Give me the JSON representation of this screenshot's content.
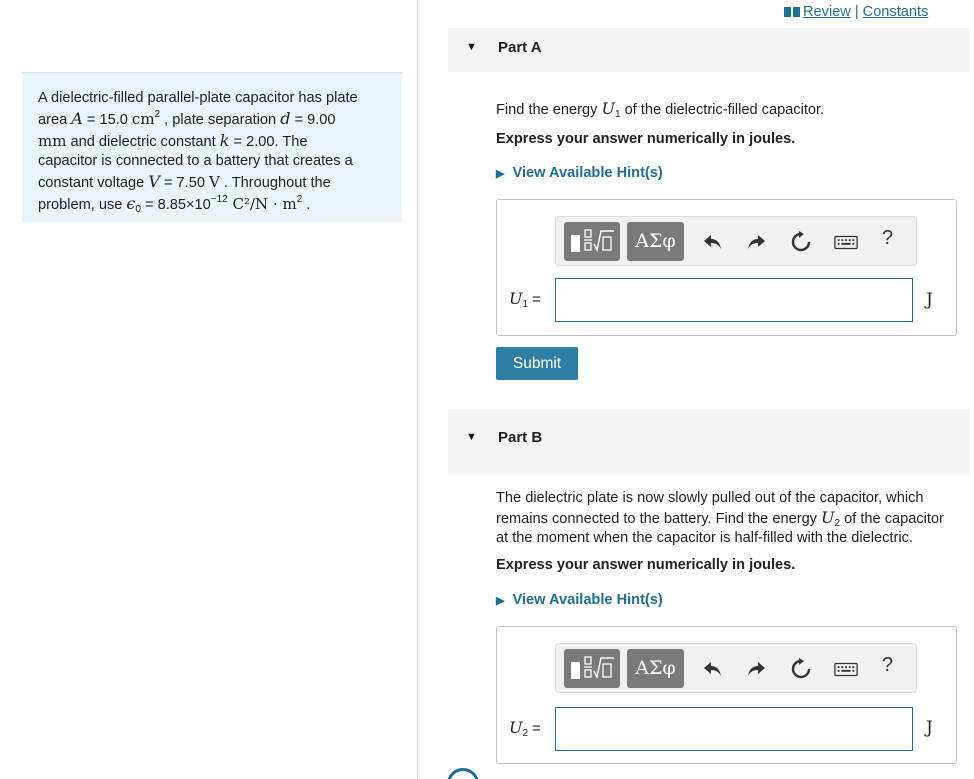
{
  "header": {
    "review_label": "Review",
    "separator": "|",
    "constants_label": "Constants"
  },
  "problem": {
    "l1": "A dielectric-filled parallel-plate capacitor has plate",
    "l2_a": "area ",
    "l2_A": "A",
    "l2_b": " = 15.0 ",
    "l2_unit": "cm",
    "l2_unit_exp": "2",
    "l2_c": " , plate separation ",
    "l2_d": "d",
    "l2_e": " = 9.00",
    "l3_unit": "mm",
    "l3_a": " and dielectric constant ",
    "l3_k": "k",
    "l3_b": " = 2.00. The",
    "l4": "capacitor is connected to a battery that creates a",
    "l5_a": "constant voltage ",
    "l5_V": "V",
    "l5_b": " = 7.50 ",
    "l5_unit": "V",
    "l5_c": " . Throughout the",
    "l6_a": "problem, use ",
    "l6_eps": "ϵ",
    "l6_eps_sub": "0",
    "l6_b": " = 8.85×10",
    "l6_exp": "−12",
    "l6_unit": " C²/N · m",
    "l6_unit_exp": "2",
    "l6_c": " ."
  },
  "partA": {
    "title": "Part A",
    "q_a": "Find the energy ",
    "q_var": "U",
    "q_sub": "1",
    "q_b": " of the dielectric-filled capacitor.",
    "instruction": "Express your answer numerically in joules.",
    "hint": "View Available Hint(s)",
    "var": "U",
    "var_sub": "1",
    "eq": "=",
    "value": "",
    "unit": "J",
    "submit": "Submit"
  },
  "partB": {
    "title": "Part B",
    "q1": "The dielectric plate is now slowly pulled out of the capacitor, which",
    "q2_a": "remains connected to the battery. Find the energy ",
    "q2_var": "U",
    "q2_sub": "2",
    "q2_b": " of the capacitor",
    "q3": "at the moment when the capacitor is half-filled with the dielectric.",
    "instruction": "Express your answer numerically in joules.",
    "hint": "View Available Hint(s)",
    "var": "U",
    "var_sub": "2",
    "eq": "=",
    "value": "",
    "unit": "J"
  },
  "toolbar": {
    "greek_label": "ΑΣφ",
    "help_label": "?",
    "icons": [
      "templates-icon",
      "greek-icon",
      "undo-icon",
      "redo-icon",
      "reset-icon",
      "keyboard-icon",
      "help-icon"
    ]
  },
  "colors": {
    "accent": "#1d6f96",
    "button": "#2e7da3",
    "problem_bg": "#e9f5f8",
    "part_header_bg": "#f5f5f5"
  }
}
